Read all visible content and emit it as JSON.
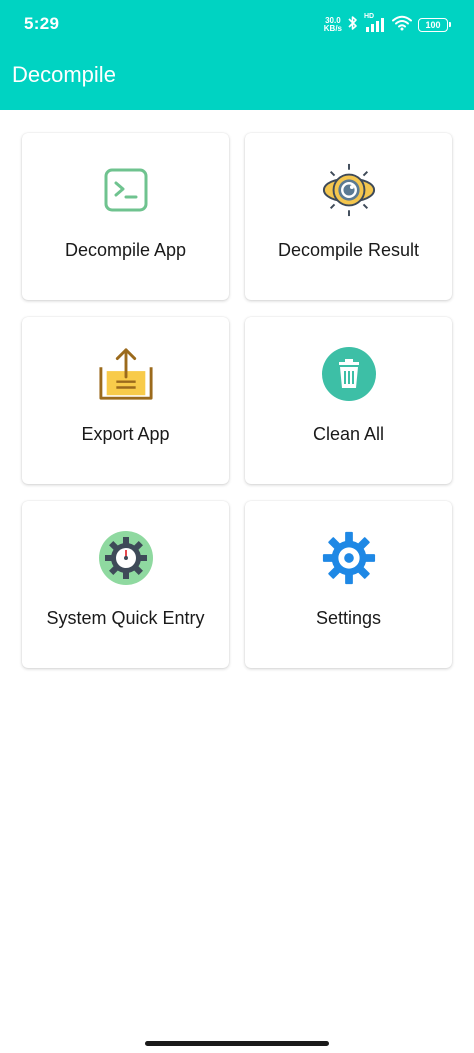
{
  "status_bar": {
    "time": "5:29",
    "net_speed_value": "30.0",
    "net_speed_unit": "KB/s",
    "network_label": "HD",
    "battery": "100"
  },
  "app_bar": {
    "title": "Decompile",
    "color": "#00D3C2"
  },
  "cards": [
    {
      "label": "Decompile App",
      "icon": "terminal-icon"
    },
    {
      "label": "Decompile Result",
      "icon": "gear-result-icon"
    },
    {
      "label": "Export App",
      "icon": "export-icon"
    },
    {
      "label": "Clean All",
      "icon": "trash-icon"
    },
    {
      "label": "System Quick Entry",
      "icon": "gauge-gear-icon"
    },
    {
      "label": "Settings",
      "icon": "settings-gear-icon"
    }
  ]
}
